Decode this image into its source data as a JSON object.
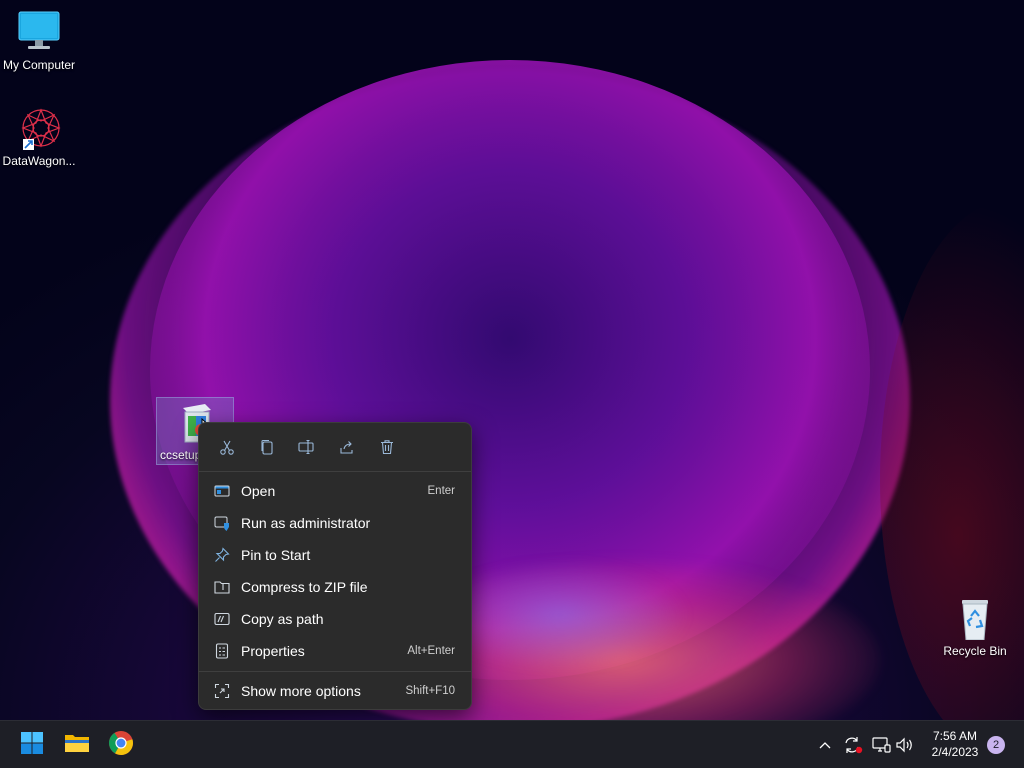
{
  "desktop": {
    "icons": [
      {
        "label": "My Computer",
        "icon": "monitor-icon"
      },
      {
        "label": "DataWagon...",
        "icon": "datawagon-app-icon"
      },
      {
        "label": "ccsetup",
        "icon": "installer-icon"
      },
      {
        "label": "Recycle Bin",
        "icon": "recycle-bin-icon"
      }
    ]
  },
  "context_menu": {
    "quick_actions": [
      {
        "name": "cut",
        "icon": "scissors-icon"
      },
      {
        "name": "copy",
        "icon": "copy-icon"
      },
      {
        "name": "rename",
        "icon": "rename-icon"
      },
      {
        "name": "share",
        "icon": "share-icon"
      },
      {
        "name": "delete",
        "icon": "trash-icon"
      }
    ],
    "items": [
      {
        "label": "Open",
        "shortcut": "Enter",
        "icon": "open-icon"
      },
      {
        "label": "Run as administrator",
        "shortcut": "",
        "icon": "shield-icon"
      },
      {
        "label": "Pin to Start",
        "shortcut": "",
        "icon": "pin-icon"
      },
      {
        "label": "Compress to ZIP file",
        "shortcut": "",
        "icon": "zip-folder-icon"
      },
      {
        "label": "Copy as path",
        "shortcut": "",
        "icon": "copy-path-icon"
      },
      {
        "label": "Properties",
        "shortcut": "Alt+Enter",
        "icon": "properties-icon"
      }
    ],
    "more": {
      "label": "Show more options",
      "shortcut": "Shift+F10",
      "icon": "more-options-icon"
    }
  },
  "taskbar": {
    "apps": [
      {
        "name": "start",
        "icon": "windows-start-icon"
      },
      {
        "name": "file-explorer",
        "icon": "folder-icon"
      },
      {
        "name": "chrome",
        "icon": "chrome-icon"
      }
    ],
    "tray_icons": [
      "chevron-up-icon",
      "sync-icon",
      "network-icon",
      "volume-icon"
    ],
    "time": "7:56 AM",
    "date": "2/4/2023",
    "notification_count": "2"
  },
  "colors": {
    "menu_bg": "#2b2b2b",
    "taskbar_bg": "#1e1f26",
    "accent_blue": "#2f8fe0"
  }
}
